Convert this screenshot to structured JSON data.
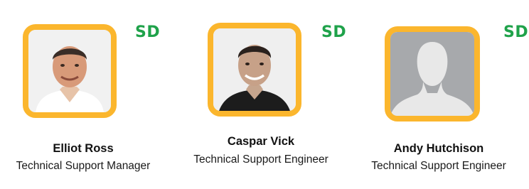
{
  "team": [
    {
      "name": "Elliot Ross",
      "role": "Technical Support Manager",
      "badge": "SD",
      "avatar": "photo-portrait"
    },
    {
      "name": "Caspar Vick",
      "role": "Technical Support Engineer",
      "badge": "SD",
      "avatar": "photo-portrait"
    },
    {
      "name": "Andy Hutchison",
      "role": "Technical Support Engineer",
      "badge": "SD",
      "avatar": "default-silhouette-icon"
    }
  ],
  "colors": {
    "frame": "#fbb62d",
    "badge": "#1fa24a",
    "silhouette_bg": "#a7a9ac",
    "silhouette_fg": "#e8e8e8"
  }
}
